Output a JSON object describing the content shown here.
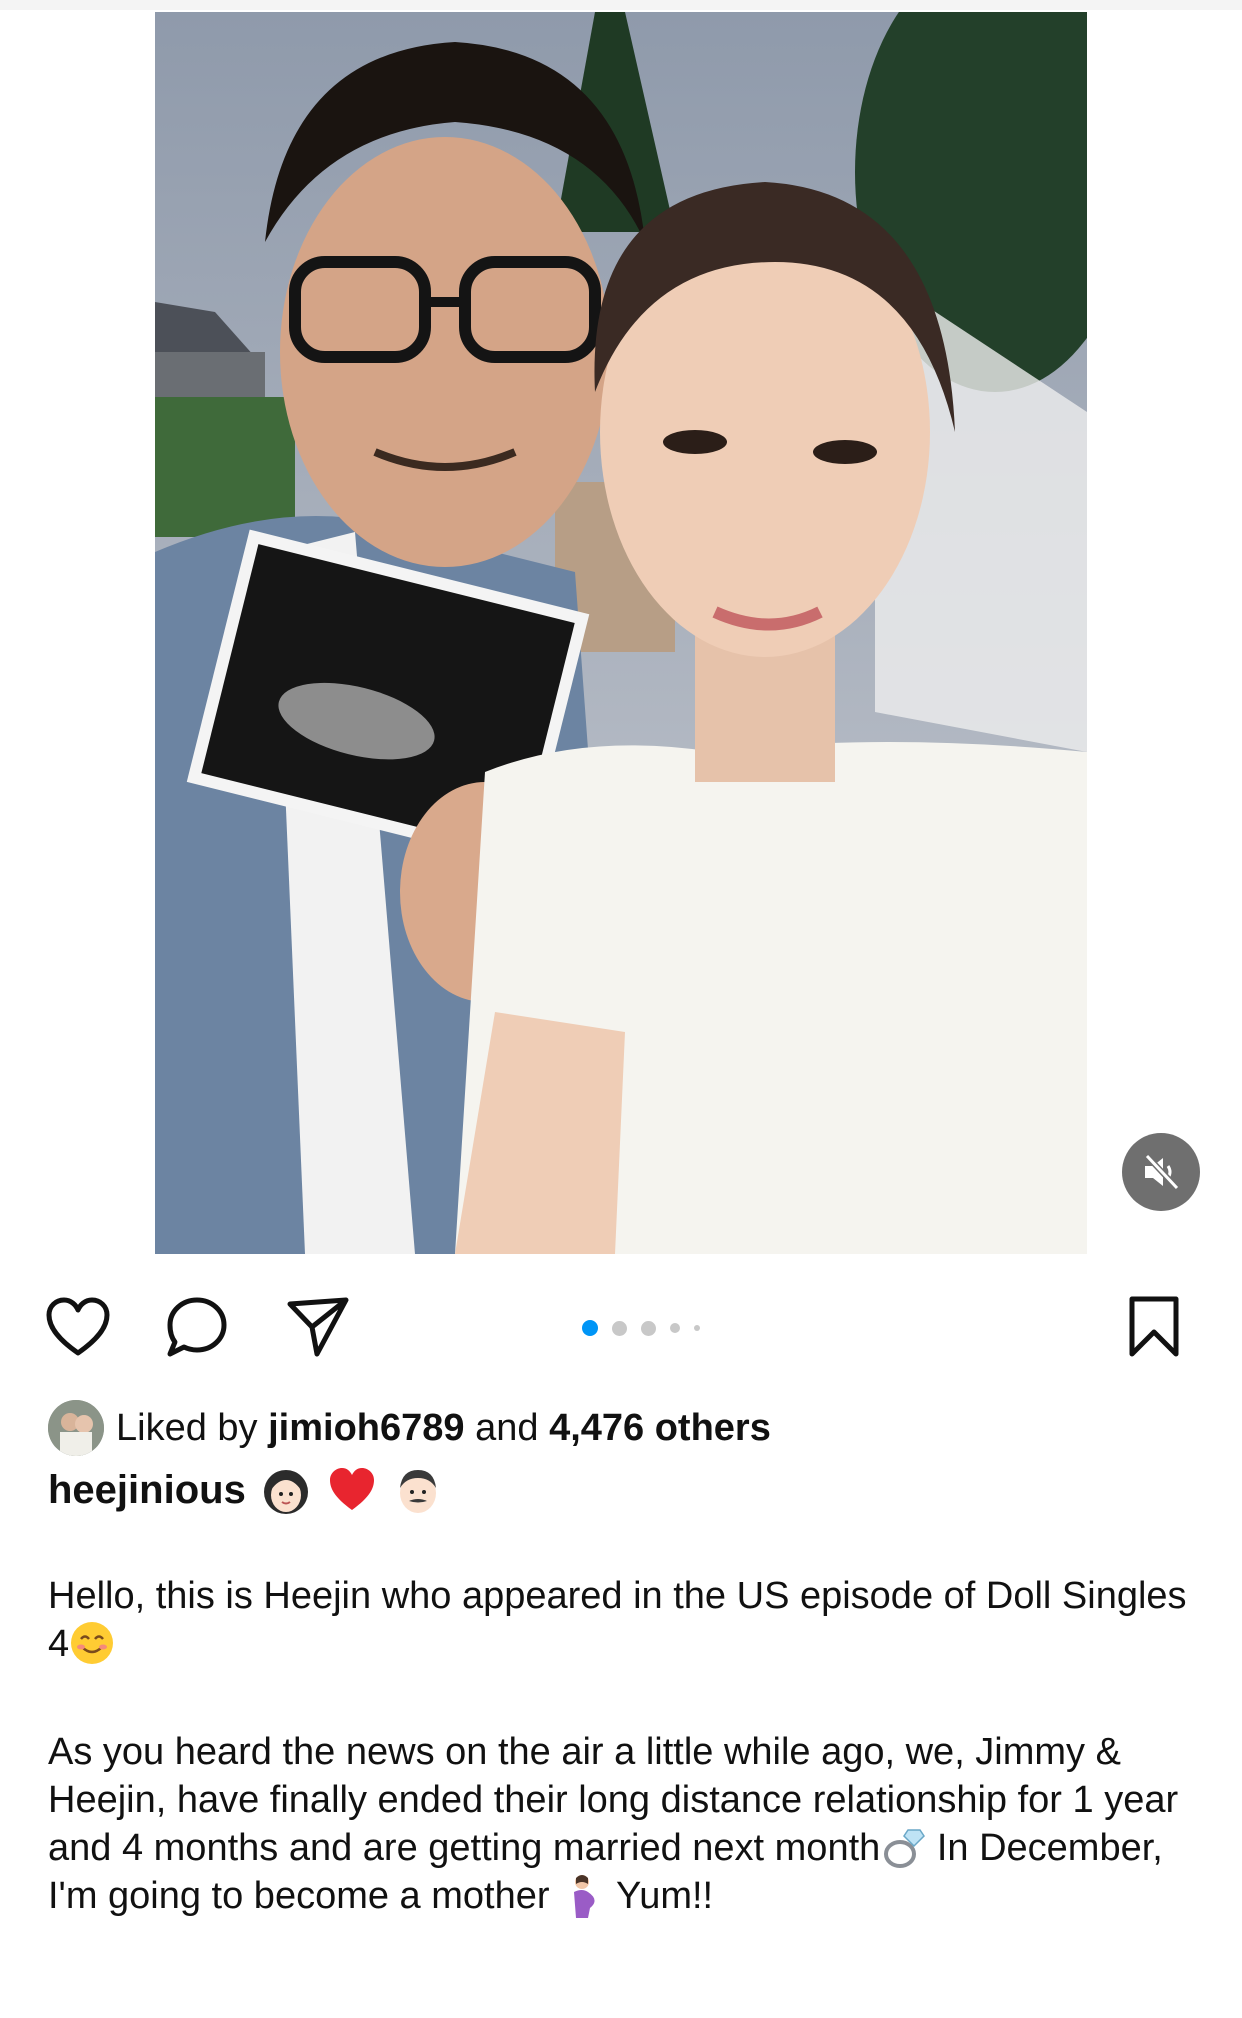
{
  "post": {
    "media": {
      "image_description_icon": "couple-selfie-photo",
      "mute_icon": "speaker-muted-icon",
      "carousel_dots": 5,
      "active_dot": 0,
      "accent_color": "#0095f6"
    },
    "actions": {
      "like_icon": "heart-icon",
      "comment_icon": "comment-icon",
      "share_icon": "send-icon",
      "save_icon": "bookmark-icon"
    },
    "likes": {
      "prefix": "Liked by",
      "user": "jimioh6789",
      "middle": "and",
      "count_text": "4,476 others"
    },
    "author": {
      "username": "heejinious",
      "emojis": [
        "woman-face-emoji",
        "red-heart-emoji",
        "man-face-emoji"
      ]
    },
    "caption": {
      "para1": "Hello, this is Heejin who appeared in the US episode of Doll Singles 4",
      "para2_part1": "As you heard the news on the air a little while ago, we, Jimmy & Heejin, have finally ended their long distance relationship for 1 year and 4 months and are getting married next month",
      "para2_part2": " In December, I'm going to become a mother",
      "para2_part3": " Yum!!"
    }
  }
}
